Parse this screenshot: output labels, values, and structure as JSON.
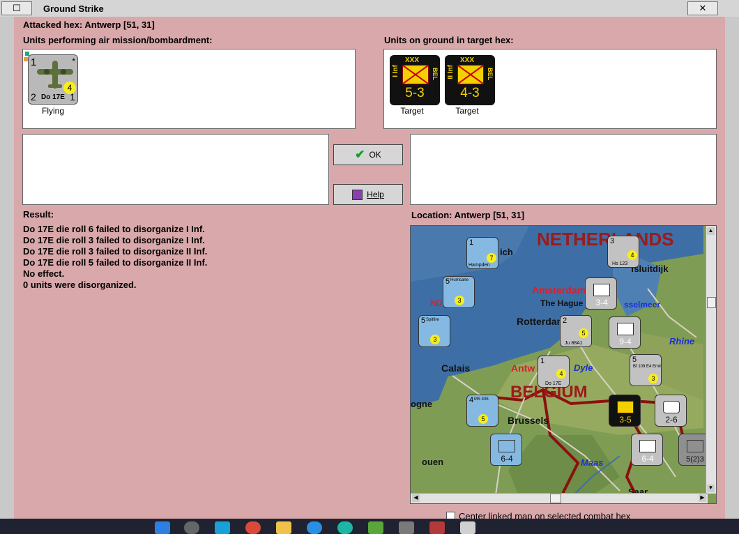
{
  "window": {
    "title": "Ground Strike"
  },
  "attacked_hex": "Attacked hex: Antwerp  [51, 31]",
  "air_units_label": "Units performing air mission/bombardment:",
  "ground_units_label": "Units on ground in target hex:",
  "air_units": [
    {
      "top_left": "1",
      "bottom_left": "2",
      "bottom_right": "1",
      "star": "*",
      "badge": "4",
      "name": "Do 17E",
      "status": "Flying"
    }
  ],
  "ground_units": [
    {
      "corps": "XXX",
      "side_label": "I Inf",
      "nation": "BEL",
      "strength": "5-3",
      "status": "Target"
    },
    {
      "corps": "XXX",
      "side_label": "II Inf",
      "nation": "BEL",
      "strength": "4-3",
      "status": "Target"
    }
  ],
  "buttons": {
    "ok": "OK",
    "help": "Help"
  },
  "result": {
    "label": "Result:",
    "lines": [
      "Do 17E die roll 6 failed to disorganize I Inf.",
      "Do 17E die roll 3 failed to disorganize I Inf.",
      "Do 17E die roll 3 failed to disorganize II Inf.",
      "Do 17E die roll 5 failed to disorganize II Inf.",
      "No effect.",
      "0 units were disorganized."
    ]
  },
  "location": "Location:  Antwerp  [51, 31]",
  "map": {
    "labels": {
      "netherlands": "NETHERLANDS",
      "belgium": "BELGIUM",
      "amsterdam": "Amsterdam",
      "hague": "The Hague",
      "rotterdam": "Rotterdam",
      "calais": "Calais",
      "brussels": "Brussels",
      "antwerp": "Antw",
      "dyle": "Dyle",
      "rhine": "Rhine",
      "maas": "Maas",
      "ijsselmeer": "sselmeer",
      "afsluitdijk": "fsluitdijk",
      "zwich": "ich",
      "nd": "ND",
      "ogne": "ogne",
      "ouen": "ouen",
      "saar": "Saar"
    },
    "counters": [
      {
        "id": "hampden",
        "top": "1",
        "badge": "7",
        "name": "Hampden"
      },
      {
        "id": "hs123",
        "top": "3",
        "badge": "4",
        "name": "Hs 123"
      },
      {
        "id": "hurricane",
        "top": "5",
        "badge": "3",
        "name": "Hurricane"
      },
      {
        "id": "spitfire",
        "top": "5",
        "badge": "3",
        "name": "Spitfire"
      },
      {
        "id": "ju88",
        "top": "2",
        "badge": "5",
        "name": "Ju 88A1"
      },
      {
        "id": "do17-map",
        "top": "1",
        "badge": "4",
        "name": "Do 17E"
      },
      {
        "id": "bf109",
        "top": "5",
        "badge": "3",
        "name": "Bf 109 E4 Emil"
      },
      {
        "id": "ms406",
        "top": "4",
        "badge": "5",
        "name": "MS 406"
      },
      {
        "id": "inf-34",
        "strength": "3-4"
      },
      {
        "id": "inf-94",
        "strength": "9-4"
      },
      {
        "id": "bel-35",
        "strength": "3-5"
      },
      {
        "id": "inf-26",
        "strength": "2-6"
      },
      {
        "id": "inf-64a",
        "strength": "6-4"
      },
      {
        "id": "inf-64b",
        "strength": "6-4"
      },
      {
        "id": "inf-52",
        "strength": "5(2)3"
      }
    ]
  },
  "center_map_checkbox": "Center linked map on selected combat hex",
  "colors": {
    "background": "#d9a8aa",
    "panel": "#ffffff",
    "ground_unit": "#111111",
    "ground_unit_stripe": "#f4d000"
  }
}
